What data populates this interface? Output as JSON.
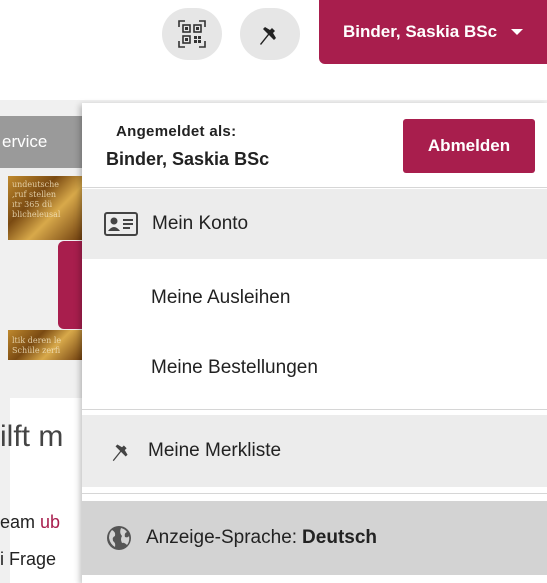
{
  "header": {
    "qr_icon": "qr-code-icon",
    "pin_icon": "pin-icon",
    "user_name": "Binder, Saskia BSc",
    "accent_color": "#a81e4d"
  },
  "background": {
    "tab_label": "ervice",
    "heading": "ilft m",
    "line1_prefix": "eam ",
    "line1_link": "ub",
    "line2": "i Frage"
  },
  "menu": {
    "logged_in_label": "Angemeldet als:",
    "logged_in_name": "Binder, Saskia BSc",
    "logout_label": "Abmelden",
    "items": [
      {
        "label": "Mein Konto",
        "icon": "id-card-icon"
      },
      {
        "label": "Meine Ausleihen"
      },
      {
        "label": "Meine Bestellungen"
      },
      {
        "label": "Meine Merkliste",
        "icon": "pin-icon"
      }
    ],
    "language": {
      "label": "Anzeige-Sprache:",
      "value": "Deutsch",
      "icon": "globe-icon"
    }
  }
}
